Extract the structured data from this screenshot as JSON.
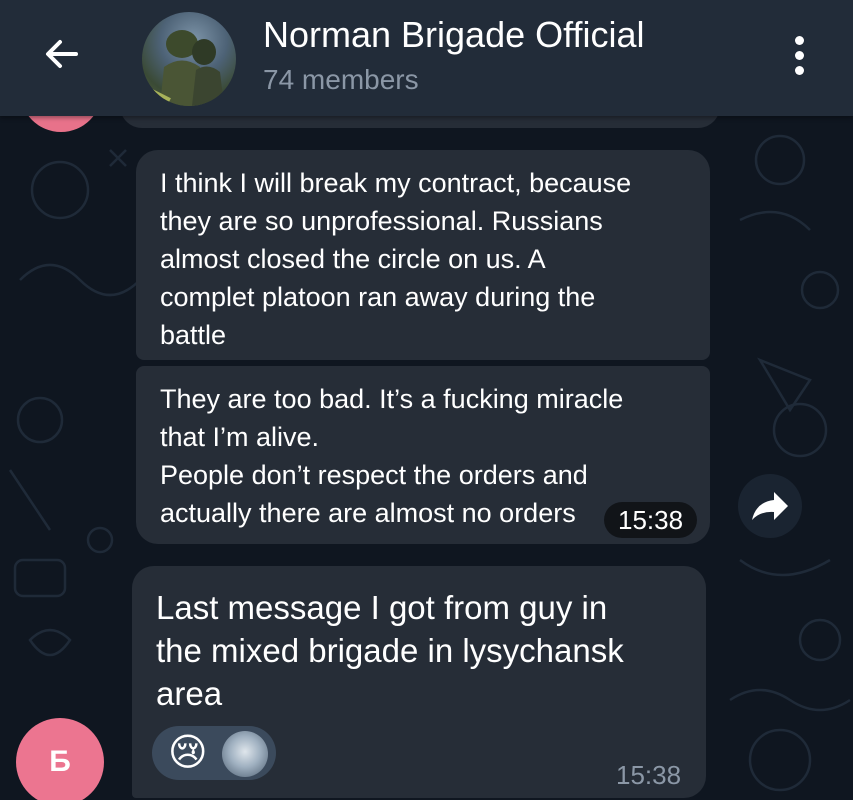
{
  "header": {
    "back_icon": "arrow-left-icon",
    "title": "Norman Brigade Official",
    "subtitle": "74 members",
    "menu_icon": "more-vertical-icon"
  },
  "messages": [
    {
      "lines": [
        "I think I will break my contract, because",
        "they are so unprofessional. Russians",
        "almost closed the circle on us. A",
        "complet platoon ran away during the",
        "battle"
      ]
    },
    {
      "lines": [
        "They are too bad. It’s a fucking miracle",
        "that I’m alive.",
        "People don’t respect the orders and",
        "actually there are almost no orders"
      ],
      "time": "15:38"
    },
    {
      "lines": [
        "Last message I got from guy in",
        "the mixed brigade in lysychansk",
        "area"
      ],
      "time": "15:38",
      "reactions": [
        "😢"
      ]
    }
  ],
  "sender": {
    "initial": "Б"
  },
  "colors": {
    "background": "#0f1620",
    "header": "#222c39",
    "bubble": "#262d37",
    "avatar": "#ec7590",
    "secondary_text": "#8b97a6"
  }
}
